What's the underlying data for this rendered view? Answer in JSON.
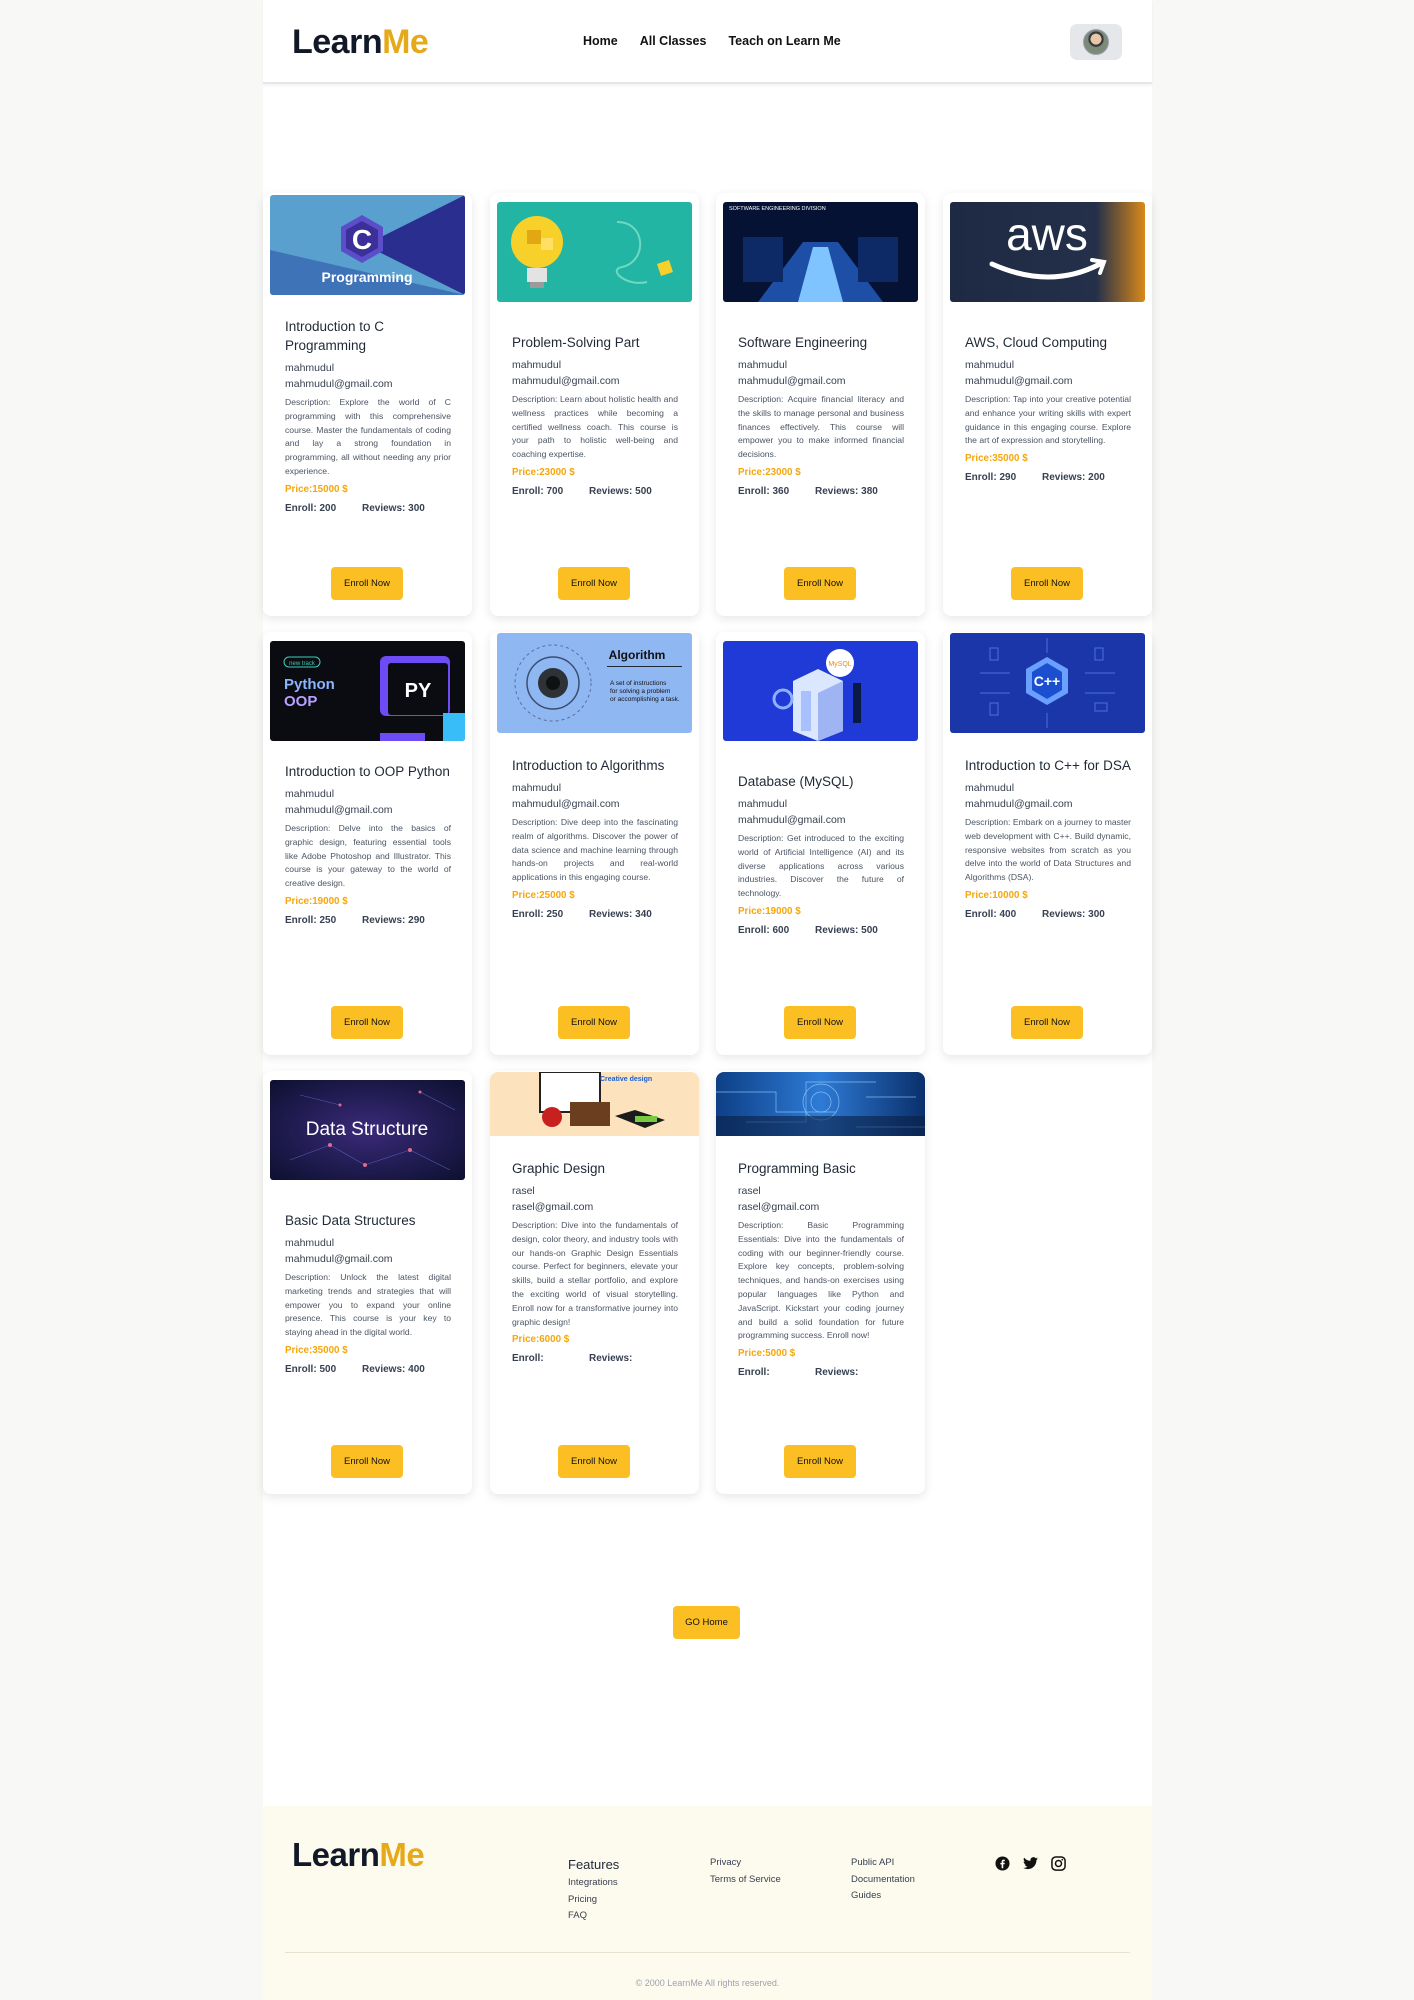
{
  "header": {
    "logo_part1": "Learn",
    "logo_part2": "Me",
    "nav": [
      "Home",
      "All Classes",
      "Teach on Learn Me"
    ]
  },
  "colors": {
    "accent": "#fbbf24",
    "price": "#f5a60a",
    "logo_me": "#e5a91a"
  },
  "courses": [
    {
      "title": "Introduction to C Programming",
      "author": "mahmudul",
      "email": "mahmudul@gmail.com",
      "description": "Description: Explore the world of C programming with this comprehensive course. Master the fundamentals of coding and lay a strong foundation in programming, all without needing any prior experience.",
      "price": "Price:15000 $",
      "enroll": "Enroll: 200",
      "reviews": "Reviews: 300",
      "button": "Enroll Now",
      "image_text": "Programming",
      "image_letter": "C"
    },
    {
      "title": "Problem-Solving Part",
      "author": "mahmudul",
      "email": "mahmudul@gmail.com",
      "description": "Description: Learn about holistic health and wellness practices while becoming a certified wellness coach. This course is your path to holistic well-being and coaching expertise.",
      "price": "Price:23000 $",
      "enroll": "Enroll: 700",
      "reviews": "Reviews: 500",
      "button": "Enroll Now"
    },
    {
      "title": "Software Engineering",
      "author": "mahmudul",
      "email": "mahmudul@gmail.com",
      "description": "Description: Acquire financial literacy and the skills to manage personal and business finances effectively. This course will empower you to make informed financial decisions.",
      "price": "Price:23000 $",
      "enroll": "Enroll: 360",
      "reviews": "Reviews: 380",
      "button": "Enroll Now",
      "image_text": "SOFTWARE ENGINEERING DIVISION"
    },
    {
      "title": "AWS, Cloud Computing",
      "author": "mahmudul",
      "email": "mahmudul@gmail.com",
      "description": "Description: Tap into your creative potential and enhance your writing skills with expert guidance in this engaging course. Explore the art of expression and storytelling.",
      "price": "Price:35000 $",
      "enroll": "Enroll: 290",
      "reviews": "Reviews: 200",
      "button": "Enroll Now",
      "image_text": "aws"
    },
    {
      "title": "Introduction to OOP Python",
      "author": "mahmudul",
      "email": "mahmudul@gmail.com",
      "description": "Description: Delve into the basics of graphic design, featuring essential tools like Adobe Photoshop and Illustrator. This course is your gateway to the world of creative design.",
      "price": "Price:19000 $",
      "enroll": "Enroll: 250",
      "reviews": "Reviews: 290",
      "button": "Enroll Now",
      "image_text": "Python OOP",
      "image_badge": "PY",
      "image_tag": "new track"
    },
    {
      "title": "Introduction to Algorithms",
      "author": "mahmudul",
      "email": "mahmudul@gmail.com",
      "description": "Description: Dive deep into the fascinating realm of algorithms. Discover the power of data science and machine learning through hands-on projects and real-world applications in this engaging course.",
      "price": "Price:25000 $",
      "enroll": "Enroll: 250",
      "reviews": "Reviews: 340",
      "button": "Enroll Now",
      "image_text": "Algorithm",
      "image_sub": "A set of instructions for solving a problem or accomplishing a task."
    },
    {
      "title": "Database (MySQL)",
      "author": "mahmudul",
      "email": "mahmudul@gmail.com",
      "description": "Description: Get introduced to the exciting world of Artificial Intelligence (AI) and its diverse applications across various industries. Discover the future of technology.",
      "price": "Price:19000 $",
      "enroll": "Enroll: 600",
      "reviews": "Reviews: 500",
      "button": "Enroll Now",
      "image_text": "MySQL"
    },
    {
      "title": "Introduction to C++ for DSA",
      "author": "mahmudul",
      "email": "mahmudul@gmail.com",
      "description": "Description: Embark on a journey to master web development with C++. Build dynamic, responsive websites from scratch as you delve into the world of Data Structures and Algorithms (DSA).",
      "price": "Price:10000 $",
      "enroll": "Enroll: 400",
      "reviews": "Reviews: 300",
      "button": "Enroll Now",
      "image_text": "C++"
    },
    {
      "title": "Basic Data Structures",
      "author": "mahmudul",
      "email": "mahmudul@gmail.com",
      "description": "Description: Unlock the latest digital marketing trends and strategies that will empower you to expand your online presence. This course is your key to staying ahead in the digital world.",
      "price": "Price:35000 $",
      "enroll": "Enroll: 500",
      "reviews": "Reviews: 400",
      "button": "Enroll Now",
      "image_text": "Data Structure"
    },
    {
      "title": "Graphic Design",
      "author": "rasel",
      "email": "rasel@gmail.com",
      "description": "Description: Dive into the fundamentals of design, color theory, and industry tools with our hands-on Graphic Design Essentials course. Perfect for beginners, elevate your skills, build a stellar portfolio, and explore the exciting world of visual storytelling. Enroll now for a transformative journey into graphic design!",
      "price": "Price:6000 $",
      "enroll": "Enroll:",
      "reviews": "Reviews:",
      "button": "Enroll Now",
      "image_text": "Creative design"
    },
    {
      "title": "Programming Basic",
      "author": "rasel",
      "email": "rasel@gmail.com",
      "description": "Description: Basic Programming Essentials: Dive into the fundamentals of coding with our beginner-friendly course. Explore key concepts, problem-solving techniques, and hands-on exercises using popular languages like Python and JavaScript. Kickstart your coding journey and build a solid foundation for future programming success. Enroll now!",
      "price": "Price:5000 $",
      "enroll": "Enroll:",
      "reviews": "Reviews:",
      "button": "Enroll Now"
    }
  ],
  "go_home": "GO Home",
  "footer": {
    "logo_part1": "Learn",
    "logo_part2": "Me",
    "col1": {
      "head": "Features",
      "items": [
        "Integrations",
        "Pricing",
        "FAQ"
      ]
    },
    "col2": {
      "items": [
        "Privacy",
        "Terms of Service"
      ]
    },
    "col3": {
      "items": [
        "Public API",
        "Documentation",
        "Guides"
      ]
    },
    "socials": [
      "facebook-icon",
      "twitter-icon",
      "instagram-icon"
    ],
    "copyright": "© 2000 LearnMe All rights reserved."
  }
}
